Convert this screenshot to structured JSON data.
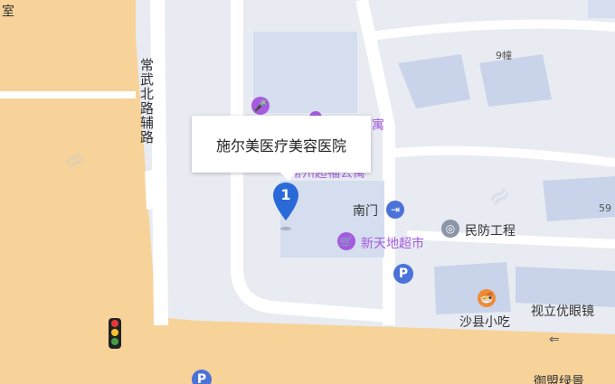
{
  "map": {
    "colors": {
      "background": "#e8ebf2",
      "main_road": "#f7d39a",
      "minor_road": "#ffffff",
      "building": "#d5deef",
      "poi_purple": "#a55be0",
      "marker": "#2a6ad8"
    },
    "roads": {
      "changwu_north_aux": "常武北路辅路"
    },
    "popup": {
      "title": "施尔美医疗美容医院"
    },
    "marker": {
      "number": "1"
    },
    "labels": {
      "top_left_fragment": "室",
      "building_9": "9幢",
      "building_59": "59",
      "apartment_partial": "寓",
      "apartment_hidden": "常州超福公寓",
      "south_gate": "南门",
      "xintiandi": "新天地超市",
      "minfang": "民防工程",
      "shaxian": "沙县小吃",
      "shili": "视立优眼镜",
      "bottom_fragment": "御盟绿景"
    },
    "icons": {
      "ktv": "microphone-icon",
      "gate": "gate-icon",
      "supermarket": "cart-icon",
      "civil_defense": "civil-defense-icon",
      "snack": "restaurant-icon",
      "parking": "parking-icon",
      "traffic_light": "traffic-light-icon",
      "arrow": "left-arrow-icon"
    },
    "parking_label": "P"
  }
}
